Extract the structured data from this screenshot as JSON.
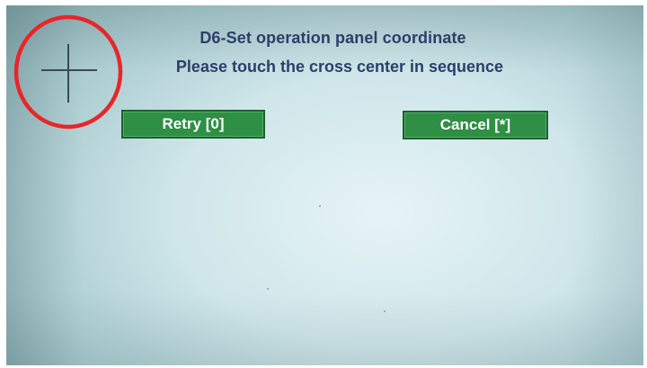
{
  "dialog": {
    "title": "D6-Set operation panel coordinate",
    "instruction": "Please touch the cross center in sequence"
  },
  "buttons": {
    "retry_label": "Retry [0]",
    "cancel_label": "Cancel [*]"
  },
  "colors": {
    "text": "#2b3f6a",
    "button_bg": "#2e8f45",
    "button_border": "#1f5f2e",
    "highlight_circle": "#e8262a"
  },
  "icons": {
    "touch_target": "crosshair-icon"
  }
}
